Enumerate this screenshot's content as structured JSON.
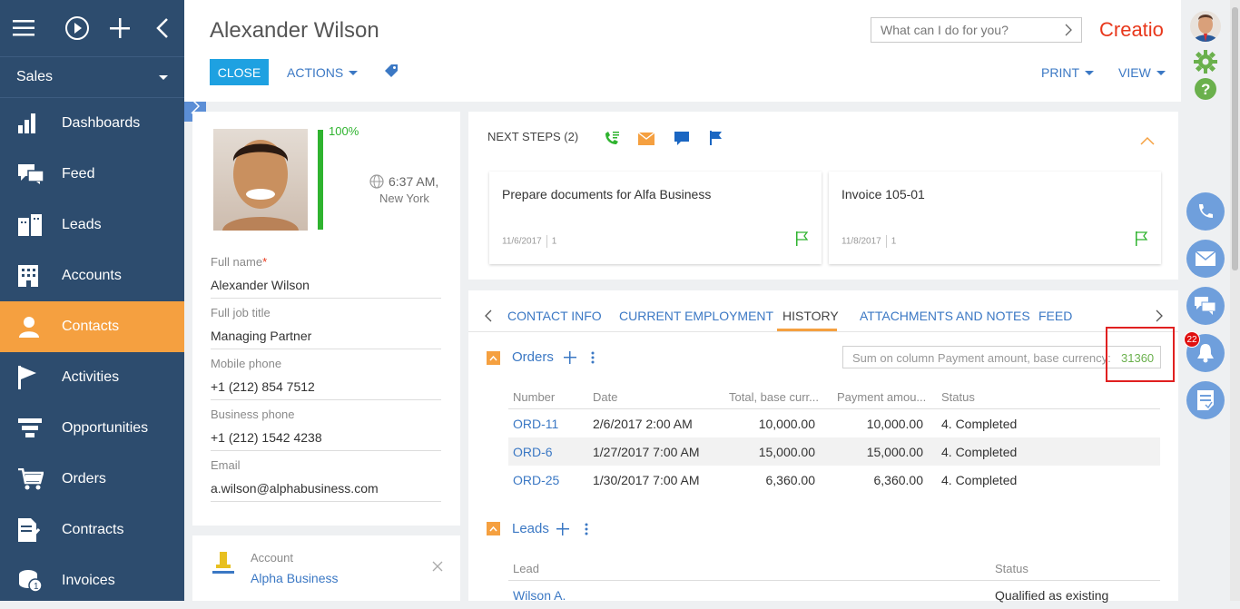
{
  "sidebar": {
    "workspace": "Sales",
    "items": [
      {
        "label": "Dashboards",
        "icon": "dashboards-icon"
      },
      {
        "label": "Feed",
        "icon": "feed-icon"
      },
      {
        "label": "Leads",
        "icon": "leads-icon"
      },
      {
        "label": "Accounts",
        "icon": "accounts-icon"
      },
      {
        "label": "Contacts",
        "icon": "contacts-icon",
        "active": true
      },
      {
        "label": "Activities",
        "icon": "flag-icon"
      },
      {
        "label": "Opportunities",
        "icon": "funnel-icon"
      },
      {
        "label": "Orders",
        "icon": "cart-icon"
      },
      {
        "label": "Contracts",
        "icon": "contract-icon"
      },
      {
        "label": "Invoices",
        "icon": "coins-icon"
      }
    ],
    "accent_color": "#f5a040"
  },
  "header": {
    "title": "Alexander Wilson",
    "search_placeholder": "What can I do for you?",
    "logo_text": "Creatio",
    "close_label": "CLOSE",
    "actions_label": "ACTIONS",
    "print_label": "PRINT",
    "view_label": "VIEW"
  },
  "profile": {
    "completeness": "100%",
    "time": "6:37 AM,",
    "city": "New York",
    "fields": [
      {
        "label": "Full name",
        "value": "Alexander Wilson",
        "required": "*"
      },
      {
        "label": "Full job title",
        "value": "Managing Partner"
      },
      {
        "label": "Mobile phone",
        "value": "+1 (212) 854 7512"
      },
      {
        "label": "Business phone",
        "value": "+1 (212) 1542 4238"
      },
      {
        "label": "Email",
        "value": "a.wilson@alphabusiness.com"
      }
    ]
  },
  "account": {
    "label": "Account",
    "value": "Alpha Business"
  },
  "next_steps": {
    "title": "NEXT STEPS (2)",
    "cards": [
      {
        "title": "Prepare documents for Alfa Business",
        "date": "11/6/2017",
        "count": "1"
      },
      {
        "title": "Invoice 105-01",
        "date": "11/8/2017",
        "count": "1"
      }
    ]
  },
  "tabs": [
    "CONTACT INFO",
    "CURRENT EMPLOYMENT",
    "HISTORY",
    "ATTACHMENTS AND NOTES",
    "FEED"
  ],
  "active_tab": "HISTORY",
  "orders": {
    "title": "Orders",
    "sum_label": "Sum on column Payment amount, base currency:",
    "sum_value": "31360",
    "columns": [
      "Number",
      "Date",
      "Total, base curr...",
      "Payment amou...",
      "Status"
    ],
    "rows": [
      {
        "number": "ORD-11",
        "date": "2/6/2017 2:00 AM",
        "total": "10,000.00",
        "payment": "10,000.00",
        "status": "4. Completed"
      },
      {
        "number": "ORD-6",
        "date": "1/27/2017 7:00 AM",
        "total": "15,000.00",
        "payment": "15,000.00",
        "status": "4. Completed"
      },
      {
        "number": "ORD-25",
        "date": "1/30/2017 7:00 AM",
        "total": "6,360.00",
        "payment": "6,360.00",
        "status": "4. Completed"
      }
    ]
  },
  "leads": {
    "title": "Leads",
    "columns": [
      "Lead",
      "Status"
    ],
    "rows": [
      {
        "lead": "Wilson A.",
        "status": "Qualified as existing"
      }
    ]
  },
  "notifications": {
    "count": "22"
  }
}
